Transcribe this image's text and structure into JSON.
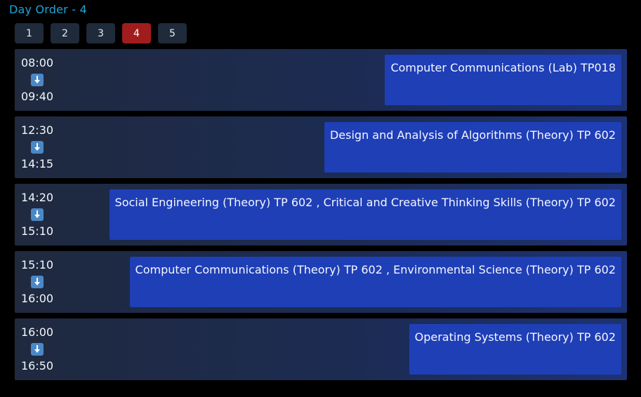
{
  "heading": "Day Order - 4",
  "day_tabs": [
    "1",
    "2",
    "3",
    "4",
    "5"
  ],
  "active_day": "4",
  "slots": [
    {
      "start": "08:00",
      "end": "09:40",
      "course": "Computer Communications (Lab) TP018"
    },
    {
      "start": "12:30",
      "end": "14:15",
      "course": "Design and Analysis of Algorithms (Theory) TP 602"
    },
    {
      "start": "14:20",
      "end": "15:10",
      "course": "Social Engineering (Theory) TP 602 , Critical and Creative Thinking Skills (Theory) TP 602"
    },
    {
      "start": "15:10",
      "end": "16:00",
      "course": "Computer Communications (Theory) TP 602 , Environmental Science (Theory) TP 602"
    },
    {
      "start": "16:00",
      "end": "16:50",
      "course": "Operating Systems (Theory) TP 602"
    }
  ],
  "icons": {
    "time_arrow": "down-arrow-icon"
  },
  "colors": {
    "heading": "#1fa3d6",
    "active_tab": "#a11d1d",
    "tab": "#1f2a3a",
    "course_block": "#1f3fb7"
  }
}
